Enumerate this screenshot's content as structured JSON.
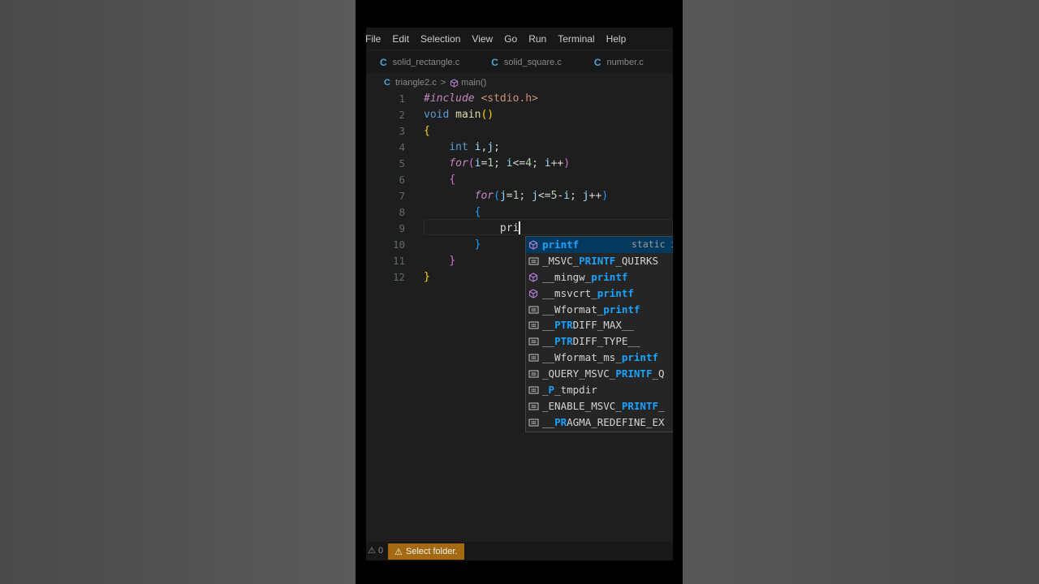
{
  "menubar": {
    "items": [
      "File",
      "Edit",
      "Selection",
      "View",
      "Go",
      "Run",
      "Terminal",
      "Help"
    ]
  },
  "tabs": [
    {
      "icon": "C",
      "label": "solid_rectangle.c"
    },
    {
      "icon": "C",
      "label": "solid_square.c"
    },
    {
      "icon": "C",
      "label": "number.c"
    }
  ],
  "breadcrumb": {
    "file_icon": "C",
    "file": "triangle2.c",
    "separator": ">",
    "symbol": "main()"
  },
  "editor": {
    "line_numbers": [
      "1",
      "2",
      "3",
      "4",
      "5",
      "6",
      "7",
      "8",
      "9",
      "10",
      "11",
      "12"
    ],
    "typed_text": "pri"
  },
  "suggestions": [
    {
      "icon": "method-cube-icon",
      "prefix": "",
      "match": "printf",
      "suffix": "",
      "detail": "static i"
    },
    {
      "icon": "constant-icon",
      "prefix": "_MSVC_",
      "match": "PRINTF",
      "suffix": "_QUIRKS",
      "detail": ""
    },
    {
      "icon": "method-cube-icon",
      "prefix": "__mingw_",
      "match": "printf",
      "suffix": "",
      "detail": ""
    },
    {
      "icon": "method-cube-icon",
      "prefix": "__msvcrt_",
      "match": "printf",
      "suffix": "",
      "detail": ""
    },
    {
      "icon": "constant-icon",
      "prefix": "__Wformat_",
      "match": "printf",
      "suffix": "",
      "detail": ""
    },
    {
      "icon": "constant-icon",
      "prefix": "__",
      "match": "PTR",
      "suffix": "DIFF_MAX__",
      "detail": ""
    },
    {
      "icon": "constant-icon",
      "prefix": "__",
      "match": "PTR",
      "suffix": "DIFF_TYPE__",
      "detail": ""
    },
    {
      "icon": "constant-icon",
      "prefix": "__Wformat_ms_",
      "match": "printf",
      "suffix": "",
      "detail": ""
    },
    {
      "icon": "constant-icon",
      "prefix": "_QUERY_MSVC_",
      "match": "PRINTF",
      "suffix": "_Q",
      "detail": ""
    },
    {
      "icon": "constant-icon",
      "prefix": "_",
      "match": "P",
      "suffix": "_tmpdir",
      "detail": ""
    },
    {
      "icon": "constant-icon",
      "prefix": "_ENABLE_MSVC_",
      "match": "PRINTF",
      "suffix": "_",
      "detail": ""
    },
    {
      "icon": "constant-icon",
      "prefix": "__",
      "match": "PR",
      "suffix": "AGMA_REDEFINE_EX",
      "detail": ""
    }
  ],
  "statusbar": {
    "problems": "0",
    "select_folder": "Select folder."
  },
  "colors": {
    "editor_bg": "#1e1e1e",
    "status_warning": "#a36a12",
    "match_highlight": "#18a3ff"
  }
}
